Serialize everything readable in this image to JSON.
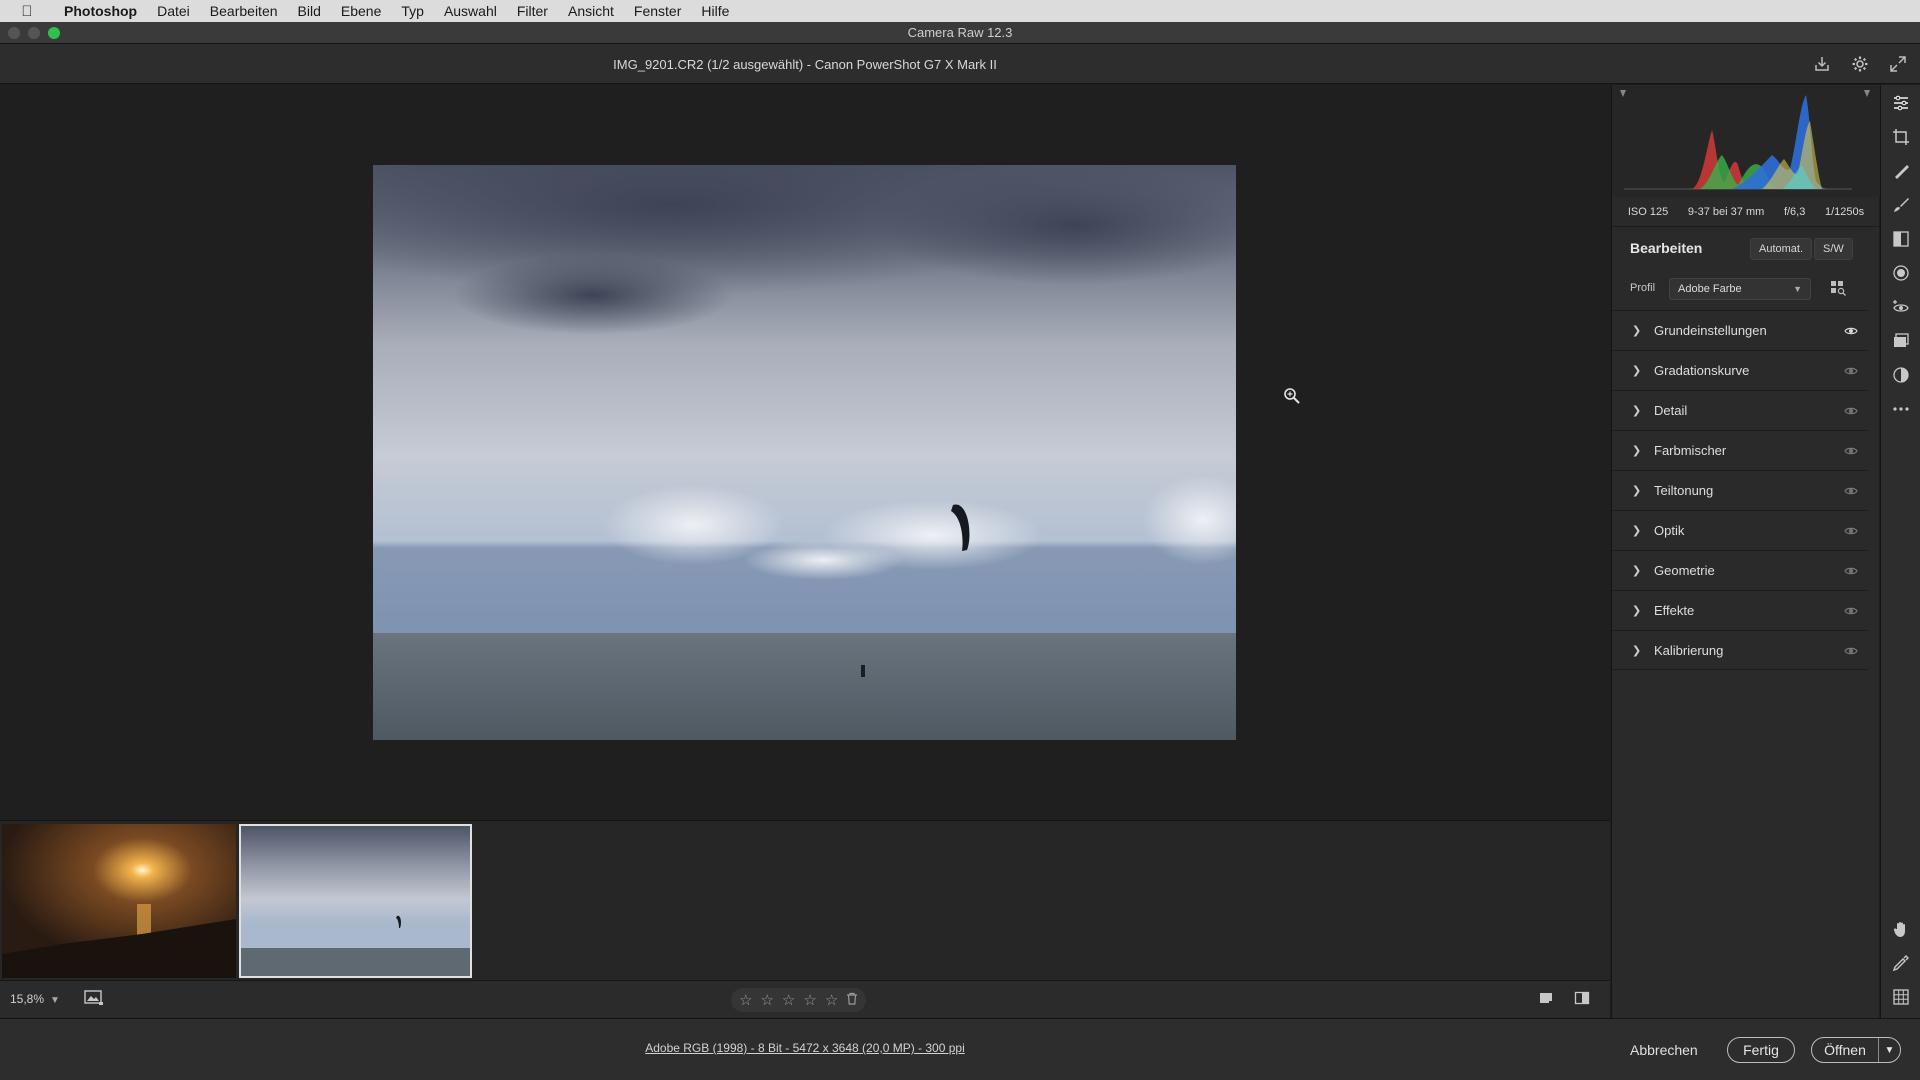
{
  "menubar": {
    "app": "Photoshop",
    "items": [
      "Datei",
      "Bearbeiten",
      "Bild",
      "Ebene",
      "Typ",
      "Auswahl",
      "Filter",
      "Ansicht",
      "Fenster",
      "Hilfe"
    ]
  },
  "window": {
    "title": "Camera Raw 12.3"
  },
  "document": {
    "title": "IMG_9201.CR2 (1/2 ausgewählt) - Canon PowerShot G7 X Mark II"
  },
  "header_icons": [
    "save-icon",
    "gear-icon",
    "fullscreen-icon"
  ],
  "exif": {
    "iso": "ISO 125",
    "lens": "9-37 bei 37 mm",
    "aperture": "f/6,3",
    "shutter": "1/1250s"
  },
  "edit": {
    "title": "Bearbeiten",
    "auto_label": "Automat.",
    "bw_label": "S/W"
  },
  "profile": {
    "label": "Profil",
    "value": "Adobe Farbe"
  },
  "sections": [
    {
      "name": "Grundeinstellungen",
      "eye_active": true
    },
    {
      "name": "Gradationskurve",
      "eye_active": false
    },
    {
      "name": "Detail",
      "eye_active": false
    },
    {
      "name": "Farbmischer",
      "eye_active": false
    },
    {
      "name": "Teiltonung",
      "eye_active": false
    },
    {
      "name": "Optik",
      "eye_active": false
    },
    {
      "name": "Geometrie",
      "eye_active": false
    },
    {
      "name": "Effekte",
      "eye_active": false
    },
    {
      "name": "Kalibrierung",
      "eye_active": false
    }
  ],
  "toolbar": {
    "zoom": "15,8%"
  },
  "rating": {
    "stars": 0,
    "max": 5
  },
  "workflow_info": "Adobe RGB (1998) - 8 Bit - 5472 x 3648 (20,0 MP) - 300 ppi",
  "buttons": {
    "cancel": "Abbrechen",
    "done": "Fertig",
    "open": "Öffnen"
  },
  "filmstrip": {
    "count": 2,
    "selected_index": 1
  },
  "colors": {
    "accent_green": "#2fc14a",
    "panel_bg": "#2a2a2a",
    "canvas_bg": "#1f1f1f"
  }
}
